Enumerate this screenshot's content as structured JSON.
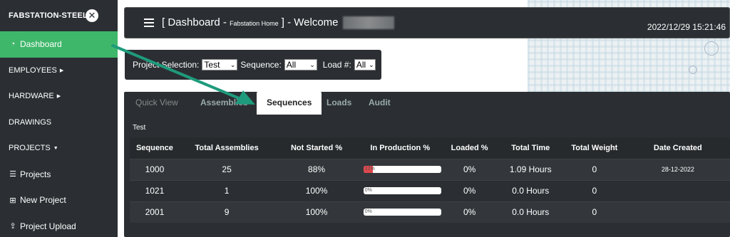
{
  "sidebar": {
    "brand": "FABSTATION-STEEL",
    "items": [
      {
        "label": "Dashboard",
        "icon": "dashboard-icon",
        "active": true
      },
      {
        "label": "EMPLOYEES",
        "icon": "caret-right-icon"
      },
      {
        "label": "HARDWARE",
        "icon": "caret-right-icon"
      },
      {
        "label": "DRAWINGS",
        "icon": ""
      },
      {
        "label": "PROJECTS",
        "icon": "caret-down-icon"
      },
      {
        "label": "Projects",
        "icon": "list-icon"
      },
      {
        "label": "New Project",
        "icon": "plus-square-icon"
      },
      {
        "label": "Project Upload",
        "icon": "upload-icon"
      }
    ]
  },
  "header": {
    "title_prefix": "[ Dashboard -",
    "title_small": "Fabstation Home",
    "title_suffix": "] - Welcome",
    "datetime": "2022/12/29 15:21:46"
  },
  "filter": {
    "project_label": "Project Selection:",
    "project_value": "Test",
    "sequence_label": "Sequence:",
    "sequence_value": "All",
    "load_label": "Load #:",
    "load_value": "All"
  },
  "tabs": [
    "Quick View",
    "Assemblies",
    "Sequences",
    "Loads",
    "Audit"
  ],
  "caption": "Test",
  "table": {
    "headers": [
      "Sequence",
      "Total Assemblies",
      "Not Started %",
      "In Production %",
      "Loaded %",
      "Total Time",
      "Total Weight",
      "Date Created"
    ],
    "rows": [
      {
        "sequence": "1000",
        "total": "25",
        "not_started": "88%",
        "production": "12%",
        "production_pct": 12,
        "loaded": "0%",
        "time": "1.09 Hours",
        "weight": "0",
        "date": "28-12-2022"
      },
      {
        "sequence": "1021",
        "total": "1",
        "not_started": "100%",
        "production": "0%",
        "production_pct": 0,
        "loaded": "0%",
        "time": "0.0 Hours",
        "weight": "0",
        "date": ""
      },
      {
        "sequence": "2001",
        "total": "9",
        "not_started": "100%",
        "production": "0%",
        "production_pct": 0,
        "loaded": "0%",
        "time": "0.0 Hours",
        "weight": "0",
        "date": ""
      }
    ]
  },
  "colors": {
    "sidebar_bg": "#2b2f33",
    "active": "#3fb76a",
    "progress": "#e0474c",
    "arrow": "#1e9b7c"
  }
}
